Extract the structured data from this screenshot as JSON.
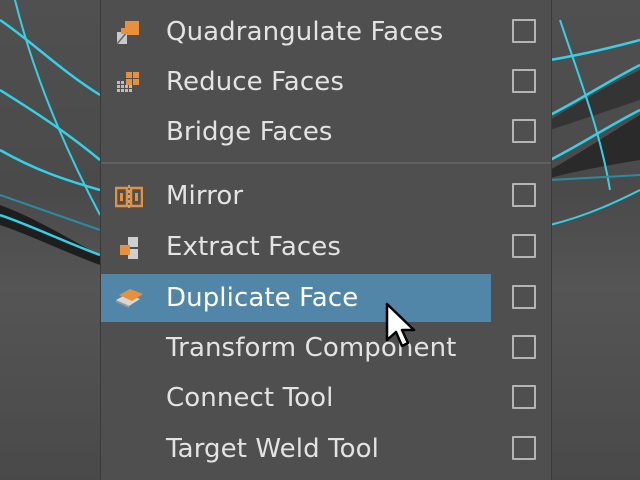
{
  "menu": {
    "items": [
      {
        "label": "Quadrangulate Faces",
        "icon": "quadrangulate-icon",
        "highlighted": false
      },
      {
        "label": "Reduce Faces",
        "icon": "reduce-faces-icon",
        "highlighted": false
      },
      {
        "label": "Bridge Faces",
        "icon": "",
        "highlighted": false
      },
      {
        "label": "Mirror",
        "icon": "mirror-icon",
        "highlighted": false
      },
      {
        "label": "Extract Faces",
        "icon": "extract-faces-icon",
        "highlighted": false
      },
      {
        "label": "Duplicate Face",
        "icon": "duplicate-face-icon",
        "highlighted": true
      },
      {
        "label": "Transform Component",
        "icon": "",
        "highlighted": false
      },
      {
        "label": "Connect Tool",
        "icon": "",
        "highlighted": false
      },
      {
        "label": "Target Weld Tool",
        "icon": "",
        "highlighted": false
      }
    ]
  },
  "colors": {
    "menu_bg": "#4f4f4f",
    "highlight": "#5286a9",
    "text": "#e3e3e3",
    "icon_orange": "#e8913a",
    "wireframe": "#34d0e8"
  }
}
